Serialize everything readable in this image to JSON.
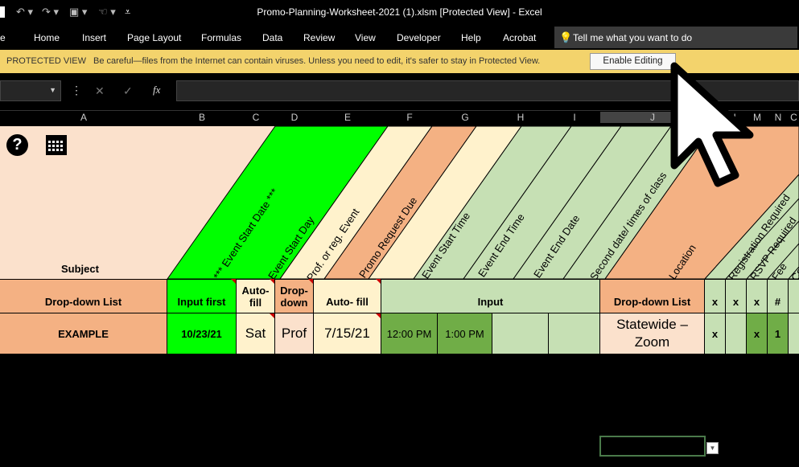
{
  "window": {
    "title": "Promo-Planning-Worksheet-2021 (1).xlsm  [Protected View]  -  Excel"
  },
  "ribbon": {
    "tabs": [
      "e",
      "Home",
      "Insert",
      "Page Layout",
      "Formulas",
      "Data",
      "Review",
      "View",
      "Developer",
      "Help",
      "Acrobat"
    ],
    "tell_me": "Tell me what you want to do"
  },
  "protected_view": {
    "label": "PROTECTED VIEW",
    "message": "Be careful—files from the Internet can contain viruses. Unless you need to edit, it's safer to stay in Protected View.",
    "button": "Enable Editing"
  },
  "formula_bar": {
    "fx": "fx",
    "cancel": "✕",
    "enter": "✓"
  },
  "columns": [
    "A",
    "B",
    "C",
    "D",
    "E",
    "F",
    "G",
    "H",
    "I",
    "J",
    "L",
    "M",
    "N",
    "C"
  ],
  "headers": {
    "subject": "Subject",
    "start_date": "*** Event Start Date ***",
    "start_day": "Event Start Day",
    "prof_reg": "Prof. or reg. Event",
    "promo_due": "Promo Request  Due",
    "start_time": "Event Start Time",
    "end_time": "Event End Time",
    "end_date": "Event End Date",
    "second_date": "Second date/ times of class",
    "location": "Location",
    "registration": "Registration Required",
    "rsvp": "RSVP Required",
    "fee": "Fee",
    "con": "Con"
  },
  "row2": {
    "a": "Drop-down List",
    "b": "Input first",
    "c": "Auto-fill",
    "d": "Drop-down",
    "e": "Auto- fill",
    "input": "Input",
    "j": "Drop-down List",
    "k": "x",
    "l": "x",
    "m": "x",
    "n": "#"
  },
  "row3": {
    "a": "EXAMPLE",
    "b": "10/23/21",
    "c": "Sat",
    "d": "Prof",
    "e": "7/15/21",
    "f": "12:00 PM",
    "g": "1:00 PM",
    "j": "Statewide – Zoom",
    "k": "x",
    "m": "x",
    "n": "1"
  },
  "colors": {
    "green_bright": "#00ff00",
    "green_input": "#66ff33",
    "peach": "#f4b183",
    "light_yellow": "#fff2cc",
    "sage": "#c6e0b4",
    "dark_green": "#70ad47",
    "protected_bar": "#f3d36c"
  }
}
